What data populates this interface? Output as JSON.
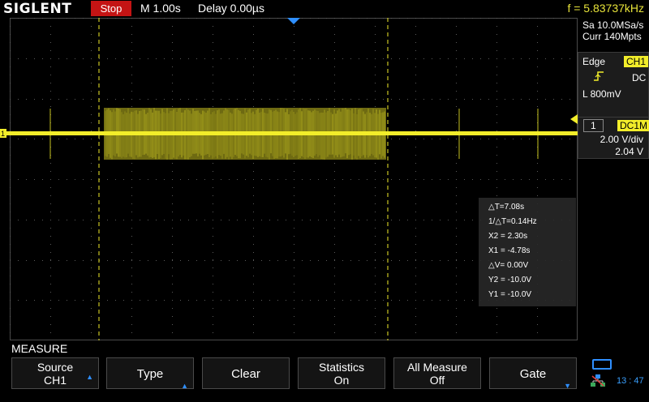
{
  "topbar": {
    "brand": "SIGLENT",
    "run_state": "Stop",
    "timebase": "M 1.00s",
    "delay": "Delay 0.00µs",
    "frequency": "f = 5.83737kHz"
  },
  "acquisition": {
    "sample_rate": "Sa 10.0MSa/s",
    "memory": "Curr 140Mpts"
  },
  "trigger": {
    "label": "Edge",
    "source": "CH1",
    "slope_icon": "rising-edge-icon",
    "coupling": "DC",
    "level": "L  800mV"
  },
  "channel1": {
    "number": "1",
    "coupling": "DC1M",
    "scale": "2.00 V/div",
    "offset": "2.04 V",
    "color": "#f2ed2a"
  },
  "cursor_readout": {
    "lines": [
      "△T=7.08s",
      "1/△T=0.14Hz",
      "X2 = 2.30s",
      "X1 = -4.78s",
      "△V= 0.00V",
      "Y2 = -10.0V",
      "Y1 = -10.0V"
    ]
  },
  "menu": {
    "title": "MEASURE",
    "softkeys": [
      {
        "line1": "Source",
        "line2": "CH1",
        "arrow": true
      },
      {
        "line1": "Type",
        "line2": "",
        "arrow": true
      },
      {
        "line1": "Clear",
        "line2": "",
        "arrow": false
      },
      {
        "line1": "Statistics",
        "line2": "On",
        "arrow": false
      },
      {
        "line1": "All Measure",
        "line2": "Off",
        "arrow": false
      },
      {
        "line1": "Gate",
        "line2": "",
        "arrow": true
      }
    ]
  },
  "status": {
    "clock": "13 : 47",
    "usb_icon": "usb-icon",
    "network_icon": "network-icon"
  },
  "colors": {
    "trace": "#f2ed2a",
    "stop": "#c41414",
    "accent": "#2f8fff"
  }
}
